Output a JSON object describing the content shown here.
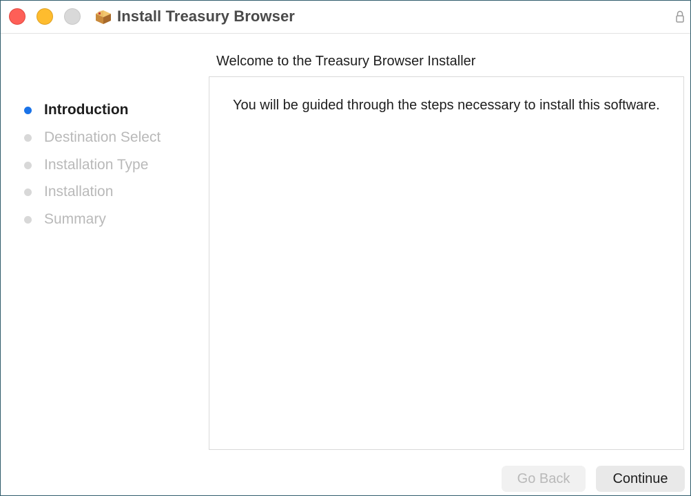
{
  "window": {
    "title": "Install Treasury Browser"
  },
  "sidebar": {
    "steps": [
      {
        "label": "Introduction",
        "active": true
      },
      {
        "label": "Destination Select",
        "active": false
      },
      {
        "label": "Installation Type",
        "active": false
      },
      {
        "label": "Installation",
        "active": false
      },
      {
        "label": "Summary",
        "active": false
      }
    ]
  },
  "main": {
    "heading": "Welcome to the Treasury Browser Installer",
    "body": "You will be guided through the steps necessary to install this software."
  },
  "buttons": {
    "back_label": "Go Back",
    "continue_label": "Continue"
  },
  "colors": {
    "accent": "#1a73e8",
    "close": "#fe5f57",
    "minimize": "#febc2e",
    "zoom_disabled": "#d9d9d9"
  },
  "icons": {
    "app": "package-icon",
    "lock": "lock-icon"
  }
}
